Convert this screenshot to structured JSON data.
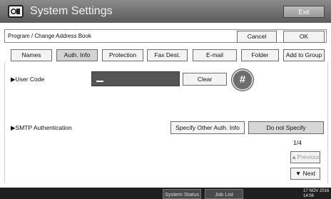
{
  "header": {
    "title": "System Settings",
    "exit_label": "Exit"
  },
  "toolbar": {
    "breadcrumb": "Program / Change Address Book",
    "cancel_label": "Cancel",
    "ok_label": "OK"
  },
  "tabs": [
    {
      "label": "Names",
      "active": false
    },
    {
      "label": "Auth. Info",
      "active": true
    },
    {
      "label": "Protection",
      "active": false
    },
    {
      "label": "Fax Dest.",
      "active": false
    },
    {
      "label": "E-mail",
      "active": false
    },
    {
      "label": "Folder",
      "active": false
    },
    {
      "label": "Add to Group",
      "active": false
    }
  ],
  "user_code": {
    "label": "▶User Code",
    "value": "",
    "clear_label": "Clear",
    "hash_label": "#"
  },
  "smtp": {
    "label": "▶SMTP Authentication",
    "specify_other_label": "Specify Other Auth. Info",
    "do_not_specify_label": "Do not Specify",
    "selected": "Do not Specify"
  },
  "pager": {
    "page": "1/4",
    "prev_label": "▲Previous",
    "next_label": "▼ Next"
  },
  "footer": {
    "system_status_label": "System Status",
    "job_list_label": "Job List",
    "date": "17 NOV  2016",
    "time": "14:56"
  },
  "colors": {
    "titlebar": "#6e6e6e",
    "active_tab": "#d4d4d4",
    "field": "#555555",
    "bottombar": "#1f1f1f"
  }
}
